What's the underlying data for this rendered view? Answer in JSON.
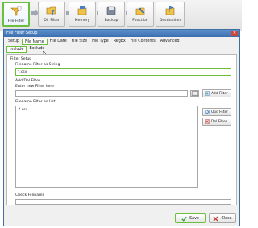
{
  "toolbar": {
    "steps": [
      {
        "label": "File Filter",
        "icon": "file-filter-icon",
        "active": true
      },
      {
        "label": "Dir Filter",
        "icon": "dir-filter-icon",
        "active": false
      },
      {
        "label": "Memory",
        "icon": "memory-icon",
        "active": false
      },
      {
        "label": "Backup",
        "icon": "backup-icon",
        "active": false
      },
      {
        "label": "Function",
        "icon": "function-icon",
        "active": false
      },
      {
        "label": "Destination",
        "icon": "destination-icon",
        "active": false
      }
    ]
  },
  "dialog": {
    "title": "File Filter Setup",
    "close_label": "✕",
    "tabs": [
      "Setup",
      "File Name",
      "File Date",
      "File Size",
      "File Type",
      "RegEx",
      "File Contents",
      "Advanced"
    ],
    "selected_tab": "File Name",
    "subtabs": [
      "Include",
      "Exclude"
    ],
    "selected_subtab": "Include",
    "filter_setup_label": "Filter Setup",
    "filename_string_label": "Filename Filter as String",
    "filename_string_value": "*.csv",
    "add_del_group_label": "Add/Del Filter",
    "new_filter_label": "Enter new Filter here",
    "new_filter_value": "",
    "add_filter_label": "Add Filter",
    "list_label": "Filename Filter as List",
    "list_items": [
      "*.csv"
    ],
    "upd_filter_label": "Upd Filter",
    "del_filter_label": "Del Filter",
    "check_filename_label": "Check Filename",
    "check_filename_value": "",
    "save_label": "Save",
    "close_button_label": "Close"
  },
  "colors": {
    "highlight": "#6cbf3c",
    "titlebar": "#3d6fae"
  }
}
